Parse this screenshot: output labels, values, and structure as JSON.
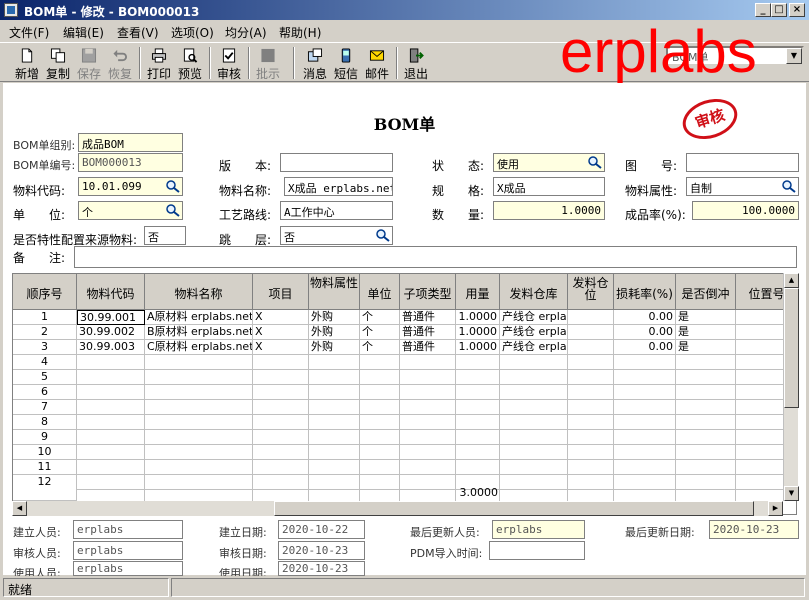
{
  "window": {
    "title": "BOM单 - 修改 - BOM000013",
    "buttons": {
      "minimize": "_",
      "maximize": "□",
      "close": "×"
    }
  },
  "menu": [
    "文件(F)",
    "编辑(E)",
    "查看(V)",
    "选项(O)",
    "均分(A)",
    "帮助(H)"
  ],
  "toolbar": {
    "new": "新增",
    "copy": "复制",
    "save": "保存",
    "restore": "恢复",
    "print": "打印",
    "preview": "预览",
    "audit": "审核",
    "batch_approve": "批示",
    "message": "消息",
    "sms": "短信",
    "mail": "邮件",
    "exit": "退出",
    "combo_value": "BOM单"
  },
  "watermark": "erplabs",
  "document": {
    "title": "BOM单",
    "stamp": "审核"
  },
  "header_fields": {
    "group_label": "BOM单组别:",
    "group_value": "成品BOM",
    "code_label": "BOM单编号:",
    "code_value": "BOM000013",
    "version_label": "版　　本:",
    "version_value": "",
    "status_label": "状　　态:",
    "status_value": "使用",
    "drawing_label": "图　　号:",
    "drawing_value": "",
    "material_code_label": "物料代码:",
    "material_code_value": "10.01.099",
    "material_name_label": "物料名称:",
    "material_name_value": "X成品 erplabs.net",
    "spec_label": "规　　格:",
    "spec_value": "X成品",
    "material_attr_label": "物料属性:",
    "material_attr_value": "自制",
    "unit_label": "单　　位:",
    "unit_value": "个",
    "route_label": "工艺路线:",
    "route_value": "A工作中心",
    "qty_label": "数　　量:",
    "qty_value": "1.0000",
    "yield_label": "成品率(%):",
    "yield_value": "100.0000",
    "special_label": "是否特性配置来源物料:",
    "special_value": "否",
    "level_label": "跳　　层:",
    "level_value": "否",
    "remark_label": "备　　注:",
    "remark_value": ""
  },
  "grid": {
    "columns": [
      "顺序号",
      "物料代码",
      "物料名称",
      "项目",
      "物料属性",
      "单位",
      "子项类型",
      "用量",
      "发料仓库",
      "发料仓位",
      "损耗率(%)",
      "是否倒冲",
      "位置号"
    ],
    "rows": [
      {
        "seq": "1",
        "code": "30.99.001",
        "name": "A原材料 erplabs.net",
        "item": "X",
        "attr": "外购",
        "unit": "个",
        "type": "普通件",
        "qty": "1.0000",
        "warehouse": "产线仓 erplabs",
        "loss": "0.00",
        "backflush": "是"
      },
      {
        "seq": "2",
        "code": "30.99.002",
        "name": "B原材料 erplabs.net",
        "item": "X",
        "attr": "外购",
        "unit": "个",
        "type": "普通件",
        "qty": "1.0000",
        "warehouse": "产线仓 erplabs",
        "loss": "0.00",
        "backflush": "是"
      },
      {
        "seq": "3",
        "code": "30.99.003",
        "name": "C原材料 erplabs.net",
        "item": "X",
        "attr": "外购",
        "unit": "个",
        "type": "普通件",
        "qty": "1.0000",
        "warehouse": "产线仓 erplabs",
        "loss": "0.00",
        "backflush": "是"
      }
    ],
    "empty_row_numbers": [
      "4",
      "5",
      "6",
      "7",
      "8",
      "9",
      "10",
      "11",
      "12"
    ],
    "total_qty": "3.0000"
  },
  "footer_fields": {
    "creator_label": "建立人员:",
    "creator_value": "erplabs",
    "create_date_label": "建立日期:",
    "create_date_value": "2020-10-22",
    "updater_label": "最后更新人员:",
    "updater_value": "erplabs",
    "update_date_label": "最后更新日期:",
    "update_date_value": "2020-10-23",
    "auditor_label": "审核人员:",
    "auditor_value": "erplabs",
    "audit_date_label": "审核日期:",
    "audit_date_value": "2020-10-23",
    "pdm_label": "PDM导入时间:",
    "pdm_value": "",
    "user_label": "使用人员:",
    "user_value": "erplabs",
    "use_date_label": "使用日期:",
    "use_date_value": "2020-10-23"
  },
  "statusbar": {
    "text": "就绪"
  },
  "colors": {
    "titlebar": "#0a246a",
    "required_field": "#ffffe1",
    "watermark": "#ff0000",
    "stamp": "#d01018"
  }
}
